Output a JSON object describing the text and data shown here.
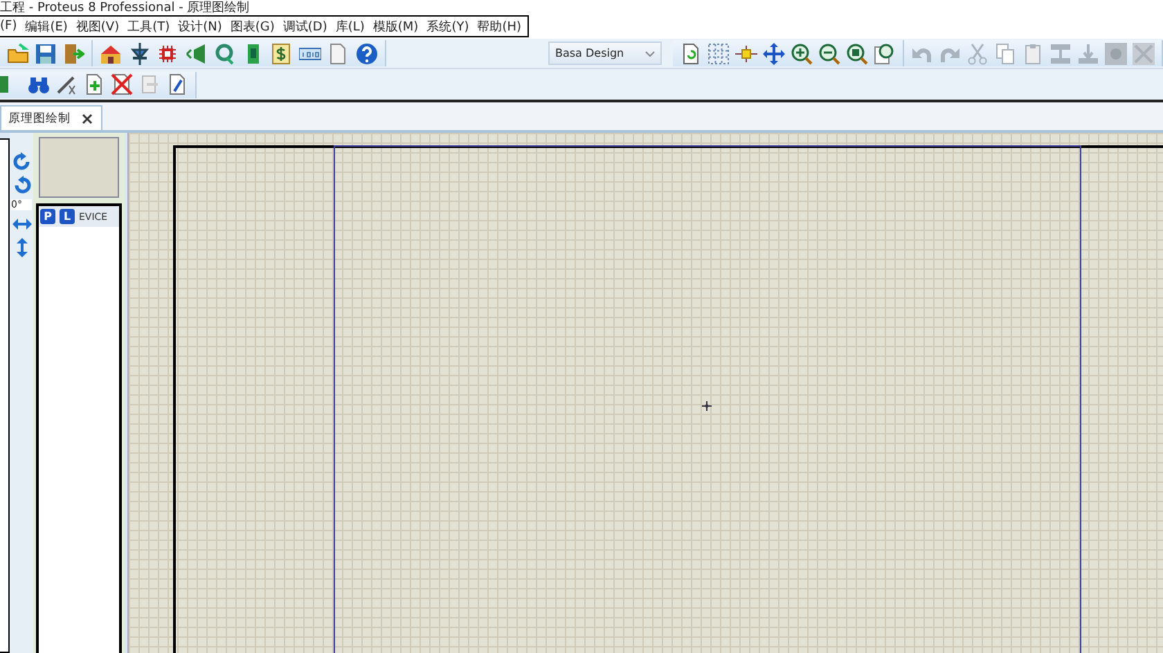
{
  "window": {
    "title": "工程 - Proteus 8 Professional - 原理图绘制"
  },
  "menu": [
    "(F)",
    "编辑(E)",
    "视图(V)",
    "工具(T)",
    "设计(N)",
    "图表(G)",
    "调试(D)",
    "库(L)",
    "模版(M)",
    "系统(Y)",
    "帮助(H)"
  ],
  "toolbar": {
    "variant_dropdown": {
      "value": "Basa Design"
    }
  },
  "tabs": [
    {
      "label": "原理图绘制",
      "selected": true
    }
  ],
  "side_tools": {
    "rotation": "0°"
  },
  "device_panel": {
    "buttons": [
      "P",
      "L"
    ],
    "title": "EVICE"
  }
}
